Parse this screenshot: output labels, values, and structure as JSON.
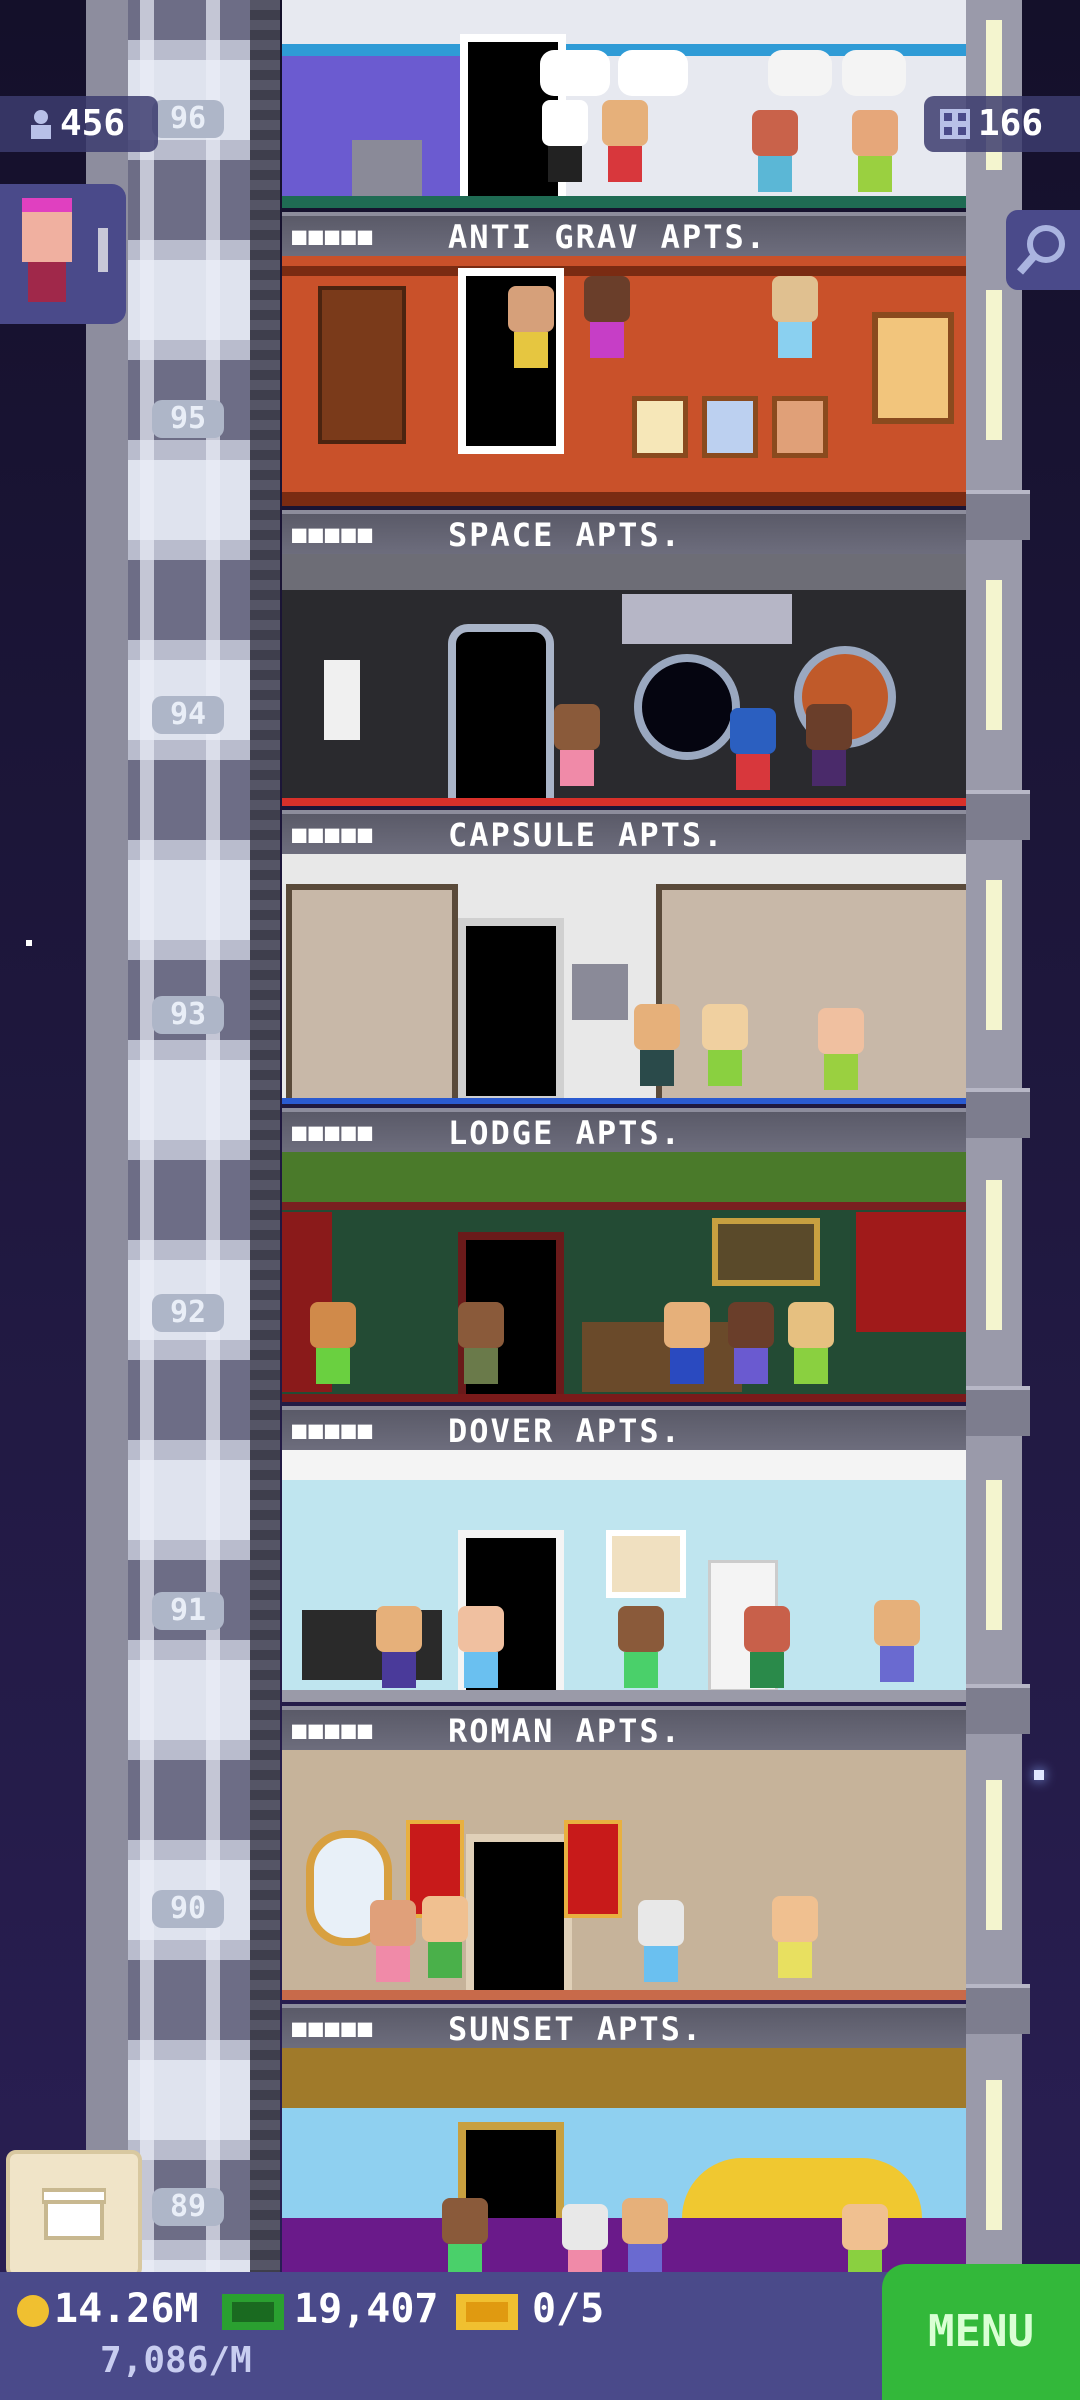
{
  "hud": {
    "population": "456",
    "floors": "166",
    "coins": "14.26M",
    "bux": "19,407",
    "tickets": "0/5",
    "income": "7,086/M",
    "menu_label": "MENU"
  },
  "floors": [
    {
      "number": "96",
      "name": "",
      "stars": ""
    },
    {
      "number": "95",
      "name": "ANTI GRAV APTS.",
      "stars": "■■■■■"
    },
    {
      "number": "94",
      "name": "SPACE APTS.",
      "stars": "■■■■■"
    },
    {
      "number": "93",
      "name": "CAPSULE APTS.",
      "stars": "■■■■■"
    },
    {
      "number": "92",
      "name": "LODGE APTS.",
      "stars": "■■■■■"
    },
    {
      "number": "91",
      "name": "DOVER APTS.",
      "stars": "■■■■■"
    },
    {
      "number": "90",
      "name": "ROMAN APTS.",
      "stars": "■■■■■"
    },
    {
      "number": "89",
      "name": "SUNSET APTS.",
      "stars": "■■■■■"
    }
  ],
  "colors": {
    "anti_grav": "#c9512a",
    "space": "#2a2a2e",
    "capsule": "#e8e8e8",
    "lodge": "#234b34",
    "dover": "#bfe5ef",
    "roman": "#c6b39a",
    "sunset": "#8fd0f0",
    "menu_green": "#33b83a"
  },
  "icons": [
    "person-icon",
    "floor-grid-icon",
    "magnifier-icon",
    "coin-icon",
    "bux-icon",
    "ticket-icon",
    "crate-icon"
  ]
}
